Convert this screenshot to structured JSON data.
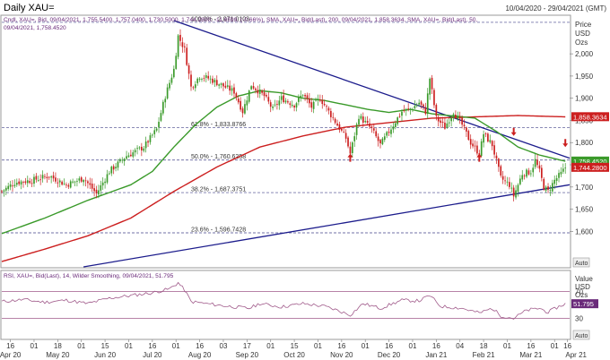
{
  "header": {
    "title": "Daily XAU=",
    "date_range": "10/04/2020 - 29/04/2021 (GMT)",
    "legend_line1": "Cndl, XAU=, Bid, 09/04/2021, 1,755.5400, 1,757.0400, 1,730.5000, 1,744.2800, -11.6599, (-0.66%), SMA, XAU=, Bid(Last), 200, 09/04/2021, 1,858.3634, SMA, XAU=, Bid(Last), 50,",
    "legend_line2": "09/04/2021, 1,758.4520"
  },
  "price_panel": {
    "axis_title_1": "Price",
    "axis_title_2": "USD",
    "axis_title_3": "Ozs",
    "auto_label": "Auto",
    "last_labels": [
      {
        "text": "1,858.3634",
        "value": 1858.36,
        "color": "#cc1f1f"
      },
      {
        "text": "1,758.4520",
        "value": 1758.45,
        "color": "#3a9a2a"
      },
      {
        "text": "1,744.2800",
        "value": 1744.28,
        "color": "#cc1f1f"
      }
    ]
  },
  "rsi_panel": {
    "legend": "RSI, XAU=, Bid(Last), 14, Wilder Smoothing, 09/04/2021, 51.795",
    "axis_title_1": "Value",
    "axis_title_2": "USD",
    "axis_title_3": "Ozs",
    "auto_label": "Auto",
    "last_label": "51.795",
    "ticks": [
      "70",
      "30"
    ]
  },
  "colors": {
    "up": "#3a9a2a",
    "down": "#cc1f1f",
    "sma200": "#cc1f1f",
    "sma50": "#3a9a2a",
    "trend": "#1c1c8c",
    "fib": "#44448a",
    "rsi": "#a05a8a",
    "arrow": "#cc1f1f"
  },
  "chart_data": {
    "type": "candlestick",
    "title": "Daily XAU=",
    "y_ticks": [
      1600,
      1650,
      1700,
      1750,
      1800,
      1850,
      1900,
      1950,
      2000
    ],
    "y_tick_labels": [
      "1,600",
      "1,650",
      "1,700",
      "1,750",
      "1,800",
      "1,850",
      "1,900",
      "1,950",
      "2,000"
    ],
    "ylim": [
      1520,
      2085
    ],
    "x_index_range": [
      0,
      264
    ],
    "x_ticks": [
      {
        "i": 4,
        "label": "16"
      },
      {
        "i": 15,
        "label": "01"
      },
      {
        "i": 26,
        "label": "18"
      },
      {
        "i": 37,
        "label": "01"
      },
      {
        "i": 48,
        "label": "15"
      },
      {
        "i": 59,
        "label": "01"
      },
      {
        "i": 70,
        "label": "16"
      },
      {
        "i": 81,
        "label": "01"
      },
      {
        "i": 92,
        "label": "16"
      },
      {
        "i": 103,
        "label": "03"
      },
      {
        "i": 114,
        "label": "17"
      },
      {
        "i": 125,
        "label": "01"
      },
      {
        "i": 136,
        "label": "15"
      },
      {
        "i": 147,
        "label": "01"
      },
      {
        "i": 158,
        "label": "16"
      },
      {
        "i": 169,
        "label": "01"
      },
      {
        "i": 180,
        "label": "16"
      },
      {
        "i": 191,
        "label": "01"
      },
      {
        "i": 202,
        "label": "16"
      },
      {
        "i": 213,
        "label": "04"
      },
      {
        "i": 224,
        "label": "18"
      },
      {
        "i": 235,
        "label": "01"
      },
      {
        "i": 246,
        "label": "16"
      },
      {
        "i": 257,
        "label": "01"
      },
      {
        "i": 263,
        "label": "16"
      }
    ],
    "x_month_labels": [
      {
        "i": 4,
        "label": "Apr 20"
      },
      {
        "i": 26,
        "label": "May 20"
      },
      {
        "i": 48,
        "label": "Jun 20"
      },
      {
        "i": 70,
        "label": "Jul 20"
      },
      {
        "i": 92,
        "label": "Aug 20"
      },
      {
        "i": 114,
        "label": "Sep 20"
      },
      {
        "i": 136,
        "label": "Oct 20"
      },
      {
        "i": 158,
        "label": "Nov 20"
      },
      {
        "i": 180,
        "label": "Dec 20"
      },
      {
        "i": 202,
        "label": "Jan 21"
      },
      {
        "i": 224,
        "label": "Feb 21"
      },
      {
        "i": 246,
        "label": "Mar 21"
      },
      {
        "i": 267,
        "label": "Apr 21"
      }
    ],
    "close_anchors": [
      [
        0,
        1690
      ],
      [
        6,
        1710
      ],
      [
        14,
        1715
      ],
      [
        22,
        1725
      ],
      [
        30,
        1705
      ],
      [
        38,
        1720
      ],
      [
        44,
        1685
      ],
      [
        50,
        1735
      ],
      [
        58,
        1770
      ],
      [
        66,
        1790
      ],
      [
        72,
        1830
      ],
      [
        76,
        1905
      ],
      [
        80,
        1965
      ],
      [
        82,
        2040
      ],
      [
        85,
        2010
      ],
      [
        88,
        1925
      ],
      [
        92,
        1950
      ],
      [
        96,
        1945
      ],
      [
        102,
        1930
      ],
      [
        108,
        1915
      ],
      [
        112,
        1870
      ],
      [
        116,
        1930
      ],
      [
        122,
        1905
      ],
      [
        126,
        1875
      ],
      [
        130,
        1900
      ],
      [
        136,
        1885
      ],
      [
        140,
        1910
      ],
      [
        144,
        1880
      ],
      [
        148,
        1900
      ],
      [
        152,
        1870
      ],
      [
        156,
        1840
      ],
      [
        160,
        1810
      ],
      [
        162,
        1775
      ],
      [
        166,
        1860
      ],
      [
        172,
        1830
      ],
      [
        176,
        1795
      ],
      [
        180,
        1825
      ],
      [
        186,
        1870
      ],
      [
        190,
        1875
      ],
      [
        194,
        1890
      ],
      [
        197,
        1870
      ],
      [
        199,
        1945
      ],
      [
        202,
        1855
      ],
      [
        206,
        1835
      ],
      [
        210,
        1870
      ],
      [
        214,
        1840
      ],
      [
        218,
        1800
      ],
      [
        222,
        1775
      ],
      [
        224,
        1820
      ],
      [
        228,
        1795
      ],
      [
        232,
        1720
      ],
      [
        236,
        1705
      ],
      [
        238,
        1680
      ],
      [
        242,
        1730
      ],
      [
        246,
        1735
      ],
      [
        248,
        1760
      ],
      [
        250,
        1735
      ],
      [
        252,
        1700
      ],
      [
        254,
        1690
      ],
      [
        257,
        1715
      ],
      [
        260,
        1730
      ],
      [
        262,
        1744
      ]
    ],
    "sma200_anchors": [
      [
        0,
        1532
      ],
      [
        20,
        1560
      ],
      [
        40,
        1590
      ],
      [
        60,
        1630
      ],
      [
        80,
        1690
      ],
      [
        100,
        1745
      ],
      [
        120,
        1790
      ],
      [
        140,
        1815
      ],
      [
        160,
        1835
      ],
      [
        180,
        1845
      ],
      [
        200,
        1855
      ],
      [
        220,
        1858
      ],
      [
        240,
        1861
      ],
      [
        262,
        1858
      ]
    ],
    "sma50_anchors": [
      [
        0,
        1595
      ],
      [
        20,
        1630
      ],
      [
        40,
        1670
      ],
      [
        60,
        1705
      ],
      [
        70,
        1735
      ],
      [
        80,
        1790
      ],
      [
        90,
        1840
      ],
      [
        100,
        1880
      ],
      [
        110,
        1905
      ],
      [
        120,
        1917
      ],
      [
        130,
        1912
      ],
      [
        140,
        1900
      ],
      [
        150,
        1895
      ],
      [
        160,
        1885
      ],
      [
        170,
        1875
      ],
      [
        180,
        1868
      ],
      [
        190,
        1875
      ],
      [
        200,
        1865
      ],
      [
        210,
        1860
      ],
      [
        220,
        1855
      ],
      [
        230,
        1825
      ],
      [
        240,
        1790
      ],
      [
        250,
        1772
      ],
      [
        262,
        1758
      ]
    ],
    "rsi_anchors": [
      [
        0,
        55
      ],
      [
        10,
        58
      ],
      [
        20,
        54
      ],
      [
        30,
        57
      ],
      [
        40,
        52
      ],
      [
        50,
        60
      ],
      [
        60,
        64
      ],
      [
        70,
        68
      ],
      [
        78,
        74
      ],
      [
        82,
        83
      ],
      [
        85,
        72
      ],
      [
        88,
        55
      ],
      [
        95,
        52
      ],
      [
        105,
        48
      ],
      [
        115,
        45
      ],
      [
        120,
        52
      ],
      [
        130,
        47
      ],
      [
        140,
        52
      ],
      [
        150,
        48
      ],
      [
        155,
        43
      ],
      [
        162,
        35
      ],
      [
        168,
        52
      ],
      [
        176,
        45
      ],
      [
        186,
        57
      ],
      [
        194,
        56
      ],
      [
        199,
        64
      ],
      [
        204,
        48
      ],
      [
        214,
        45
      ],
      [
        222,
        38
      ],
      [
        228,
        45
      ],
      [
        232,
        34
      ],
      [
        238,
        30
      ],
      [
        244,
        42
      ],
      [
        250,
        45
      ],
      [
        254,
        39
      ],
      [
        258,
        46
      ],
      [
        262,
        51.8
      ]
    ],
    "rsi_ylim": [
      0,
      100
    ],
    "fib_levels": [
      {
        "label": "100.0% - 2,071.0103",
        "value": 2071.01
      },
      {
        "label": "61.8% - 1,833.8766",
        "value": 1833.88
      },
      {
        "label": "50.0% - 1,760.6258",
        "value": 1760.63
      },
      {
        "label": "38.2% - 1,687.3751",
        "value": 1687.38
      },
      {
        "label": "23.6% - 1,596.7428",
        "value": 1596.74
      }
    ],
    "trendlines": [
      {
        "from": [
          80,
          2075
        ],
        "to": [
          264,
          1765
        ]
      },
      {
        "from": [
          38,
          1520
        ],
        "to": [
          264,
          1705
        ]
      }
    ],
    "arrows": [
      {
        "i": 162,
        "value": 1775,
        "dir": "up"
      },
      {
        "i": 222,
        "value": 1775,
        "dir": "up"
      },
      {
        "i": 238,
        "value": 1815,
        "dir": "down"
      },
      {
        "i": 262,
        "value": 1790,
        "dir": "down"
      }
    ]
  }
}
